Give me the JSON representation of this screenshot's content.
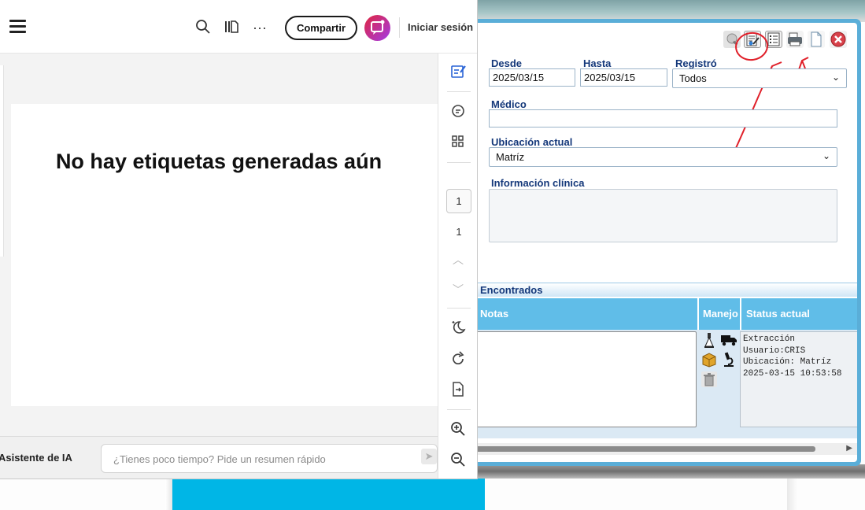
{
  "viewer": {
    "share_label": "Compartir",
    "login_label": "Iniciar sesión",
    "more_label": "···",
    "empty_message": "No hay etiquetas generadas aún",
    "page_current": "1",
    "page_total": "1",
    "ai_assistant_label": "Asistente de IA",
    "ai_placeholder": "¿Tienes poco tiempo? Pide un resumen rápido"
  },
  "form": {
    "desde_label": "Desde",
    "desde_value": "2025/03/15",
    "hasta_label": "Hasta",
    "hasta_value": "2025/03/15",
    "registro_label": "Registró",
    "registro_value": "Todos",
    "medico_label": "Médico",
    "medico_value": "",
    "ubicacion_label": "Ubicación actual",
    "ubicacion_value": "Matríz",
    "info_label": "Información clínica",
    "info_value": ""
  },
  "results": {
    "section_title": "Encontrados",
    "columns": [
      "Notas",
      "Manejo",
      "Status actual"
    ],
    "status_lines": "Extracción\nUsuario:CRIS\nUbicación: Matríz\n2025-03-15 10:53:58"
  },
  "colors": {
    "window_frame": "#5aaed8",
    "header_blue": "#60bde8",
    "label_navy": "#14387a",
    "annotation_red": "#e0202a",
    "cyan_block": "#00b6e6"
  }
}
